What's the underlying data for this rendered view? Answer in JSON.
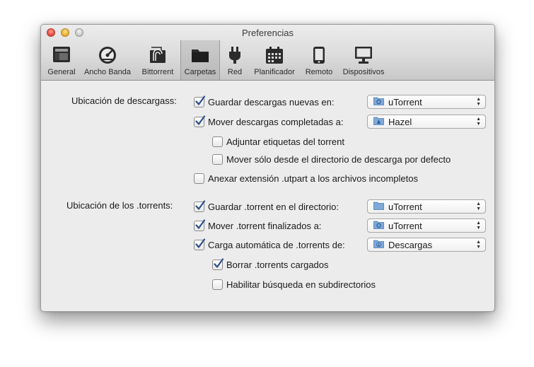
{
  "window": {
    "title": "Preferencias"
  },
  "toolbar": {
    "tabs": [
      {
        "label": "General",
        "icon": "general-icon"
      },
      {
        "label": "Ancho Banda",
        "icon": "bandwidth-gauge-icon"
      },
      {
        "label": "Bittorrent",
        "icon": "bittorrent-icon"
      },
      {
        "label": "Carpetas",
        "icon": "folder-icon",
        "selected": true
      },
      {
        "label": "Red",
        "icon": "plug-icon"
      },
      {
        "label": "Planificador",
        "icon": "calendar-icon"
      },
      {
        "label": "Remoto",
        "icon": "phone-icon"
      },
      {
        "label": "Dispositivos",
        "icon": "monitor-icon"
      }
    ]
  },
  "downloads": {
    "label": "Ubicación de descargass:",
    "save_new": {
      "label": "Guardar descargas nuevas en:",
      "checked": true,
      "popup": "uTorrent",
      "popup_icon": "utorrent-folder-icon"
    },
    "move_completed": {
      "label": "Mover descargas completadas a:",
      "checked": true,
      "popup": "Hazel",
      "popup_icon": "hazel-folder-icon"
    },
    "attach_labels": {
      "label": "Adjuntar etiquetas del torrent",
      "checked": false
    },
    "move_only_default": {
      "label": "Mover sólo desde el directorio de descarga por defecto",
      "checked": false
    },
    "append_extension": {
      "label": "Anexar extensión .utpart a los archivos incompletos",
      "checked": false
    }
  },
  "torrents": {
    "label": "Ubicación de los .torrents:",
    "save_torrent": {
      "label": "Guardar .torrent en el directorio:",
      "checked": true,
      "popup": "uTorrent",
      "popup_icon": "plain-folder-icon"
    },
    "move_finished": {
      "label": "Mover .torrent finalizados a:",
      "checked": true,
      "popup": "uTorrent",
      "popup_icon": "utorrent-folder-icon"
    },
    "autoload": {
      "label": "Carga automática de .torrents de:",
      "checked": true,
      "popup": "Descargas",
      "popup_icon": "downloads-folder-icon"
    },
    "delete_loaded": {
      "label": "Borrar .torrents cargados",
      "checked": true
    },
    "subdir_search": {
      "label": "Habilitar búsqueda en subdirectorios",
      "checked": false
    }
  },
  "colors": {
    "check": "#2d4f8a",
    "folder": "#7ea9d8",
    "accent": "#3b6fb6"
  }
}
